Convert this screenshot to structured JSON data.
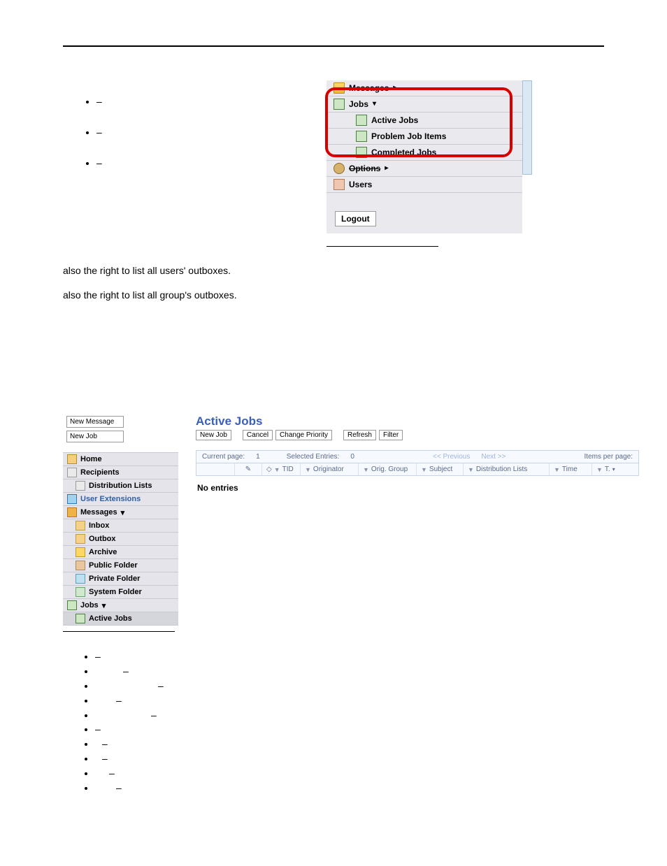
{
  "figure1": {
    "rows": {
      "messages": "Messages",
      "jobs": "Jobs",
      "active": "Active Jobs",
      "problem": "Problem Job Items",
      "completed": "Completed Jobs",
      "options": "Options",
      "users": "Users"
    },
    "logout": "Logout"
  },
  "topBullets": {
    "b1": "–",
    "b2": "–",
    "b3": "–"
  },
  "para1": "also the right to list all users' outboxes.",
  "para2": "also the right to list all group's outboxes.",
  "sidebar": {
    "newMessage": "New Message",
    "newJob": "New Job",
    "items": {
      "home": "Home",
      "recipients": "Recipients",
      "distLists": "Distribution Lists",
      "userExt": "User Extensions",
      "messages": "Messages",
      "inbox": "Inbox",
      "outbox": "Outbox",
      "archive": "Archive",
      "publicFolder": "Public Folder",
      "privateFolder": "Private Folder",
      "systemFolder": "System Folder",
      "jobs": "Jobs",
      "activeJobs": "Active Jobs"
    }
  },
  "main": {
    "heading": "Active Jobs",
    "toolbar": {
      "newJob": "New Job",
      "cancel": "Cancel",
      "changePriority": "Change Priority",
      "refresh": "Refresh",
      "filter": "Filter"
    },
    "gridbar": {
      "currentPageLabel": "Current page:",
      "currentPageValue": "1",
      "selectedLabel": "Selected Entries:",
      "selectedValue": "0",
      "prev": "<< Previous",
      "next": "Next >>",
      "itemsPerPage": "Items per page:"
    },
    "columns": {
      "tid": "TID",
      "originator": "Originator",
      "origGroup": "Orig. Group",
      "subject": "Subject",
      "distLists": "Distribution Lists",
      "time": "Time",
      "t": "T."
    },
    "noEntries": "No entries"
  },
  "lowerBullets": {
    "b1": "–",
    "b2": "–",
    "b3": "–",
    "b4": "–",
    "b5": "–",
    "b6": "–",
    "b7": "–",
    "b8": "–",
    "b9": "–",
    "b10": "–"
  }
}
